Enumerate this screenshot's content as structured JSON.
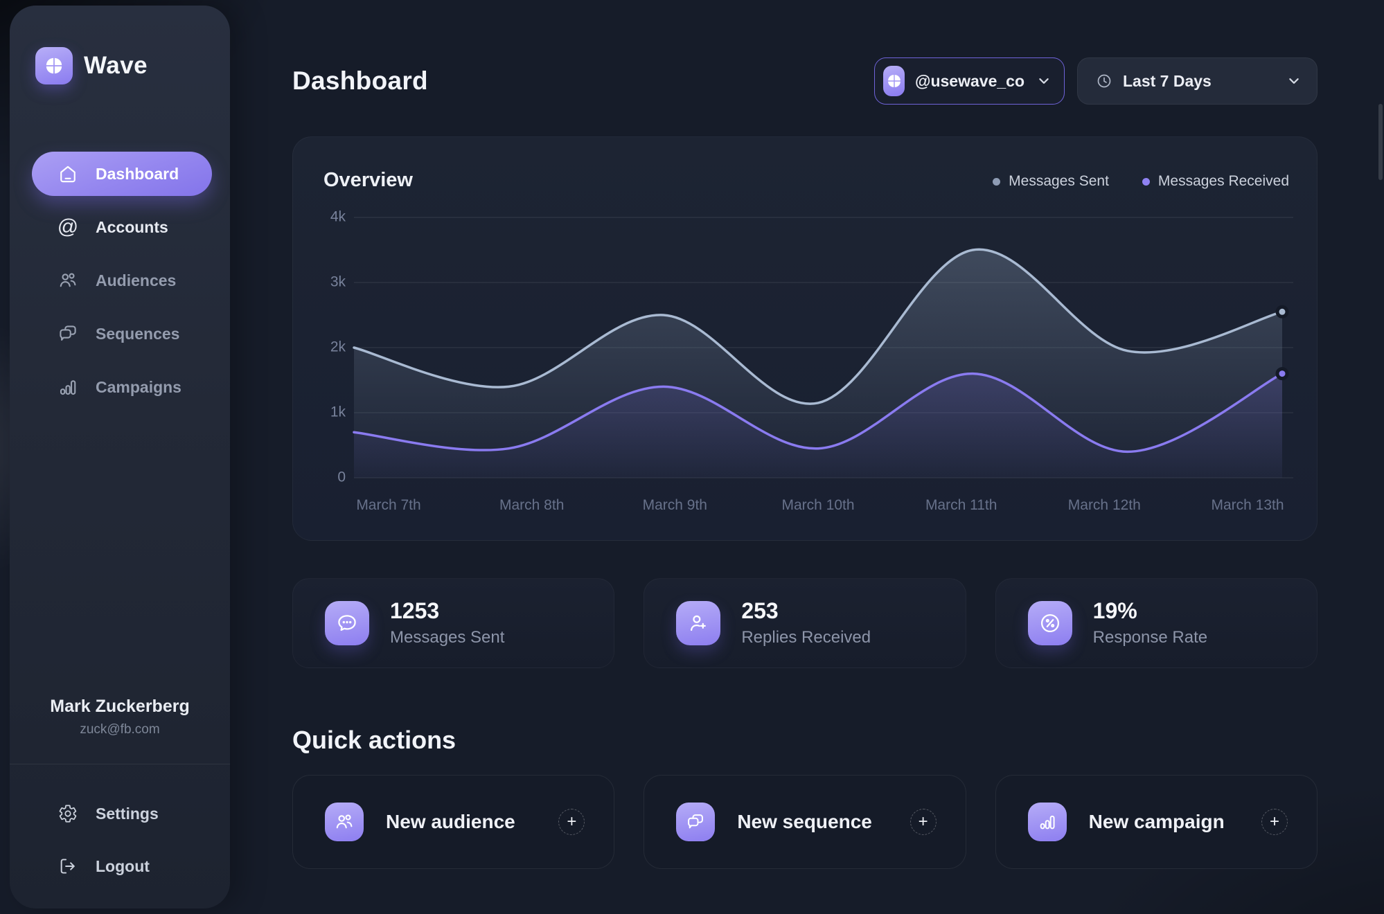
{
  "brand": {
    "name": "Wave"
  },
  "sidebar": {
    "nav": [
      {
        "label": "Dashboard",
        "icon": "home-icon",
        "active": true
      },
      {
        "label": "Accounts",
        "icon": "at-sign-icon",
        "active": false
      },
      {
        "label": "Audiences",
        "icon": "users-icon",
        "active": false
      },
      {
        "label": "Sequences",
        "icon": "chat-duo-icon",
        "active": false
      },
      {
        "label": "Campaigns",
        "icon": "bar-chart-icon",
        "active": false
      }
    ],
    "user": {
      "name": "Mark Zuckerberg",
      "email": "zuck@fb.com"
    },
    "footer": [
      {
        "label": "Settings",
        "icon": "gear-icon"
      },
      {
        "label": "Logout",
        "icon": "logout-icon"
      }
    ]
  },
  "header": {
    "title": "Dashboard",
    "account_selector": {
      "label": "@usewave_co",
      "icon": "wave-logo-icon"
    },
    "date_range": {
      "label": "Last 7 Days",
      "icon": "clock-icon"
    }
  },
  "overview": {
    "title": "Overview",
    "legend": [
      {
        "label": "Messages Sent",
        "color": "#8e9cb4"
      },
      {
        "label": "Messages Received",
        "color": "#8f82f2"
      }
    ]
  },
  "chart_data": {
    "type": "area",
    "x_labels": [
      "March 7th",
      "March 8th",
      "March 9th",
      "March 10th",
      "March 11th",
      "March 12th",
      "March 13th"
    ],
    "series": [
      {
        "name": "Messages Sent",
        "color": "#a9bad2",
        "fill_top": "rgba(160,180,208,0.30)",
        "fill_bottom": "rgba(160,180,208,0.02)",
        "values": [
          2000,
          1400,
          2500,
          1150,
          3500,
          1950,
          2550
        ]
      },
      {
        "name": "Messages Received",
        "color": "#8a7bf0",
        "fill_top": "rgba(127,111,238,0.42)",
        "fill_bottom": "rgba(127,111,238,0.03)",
        "values": [
          700,
          450,
          1400,
          450,
          1600,
          400,
          1600
        ]
      }
    ],
    "ylim": [
      0,
      4000
    ],
    "yticks": [
      {
        "value": 0,
        "label": "0"
      },
      {
        "value": 1000,
        "label": "1k"
      },
      {
        "value": 2000,
        "label": "2k"
      },
      {
        "value": 3000,
        "label": "3k"
      },
      {
        "value": 4000,
        "label": "4k"
      }
    ],
    "grid": "horizontal",
    "legend_position": "top-right",
    "end_point_markers": true
  },
  "stats": [
    {
      "value": "1253",
      "label": "Messages Sent",
      "icon": "chat-dots-icon"
    },
    {
      "value": "253",
      "label": "Replies Received",
      "icon": "person-plus-icon"
    },
    {
      "value": "19%",
      "label": "Response Rate",
      "icon": "percent-circle-icon"
    }
  ],
  "quick_actions": {
    "title": "Quick actions",
    "items": [
      {
        "label": "New audience",
        "icon": "users-icon"
      },
      {
        "label": "New sequence",
        "icon": "chat-duo-icon"
      },
      {
        "label": "New campaign",
        "icon": "bar-chart-icon"
      }
    ]
  },
  "colors": {
    "accent": "#8b7cf0",
    "accent_light": "#b3aaf6",
    "line_sent": "#a9bad2",
    "line_received": "#8a7bf0"
  }
}
